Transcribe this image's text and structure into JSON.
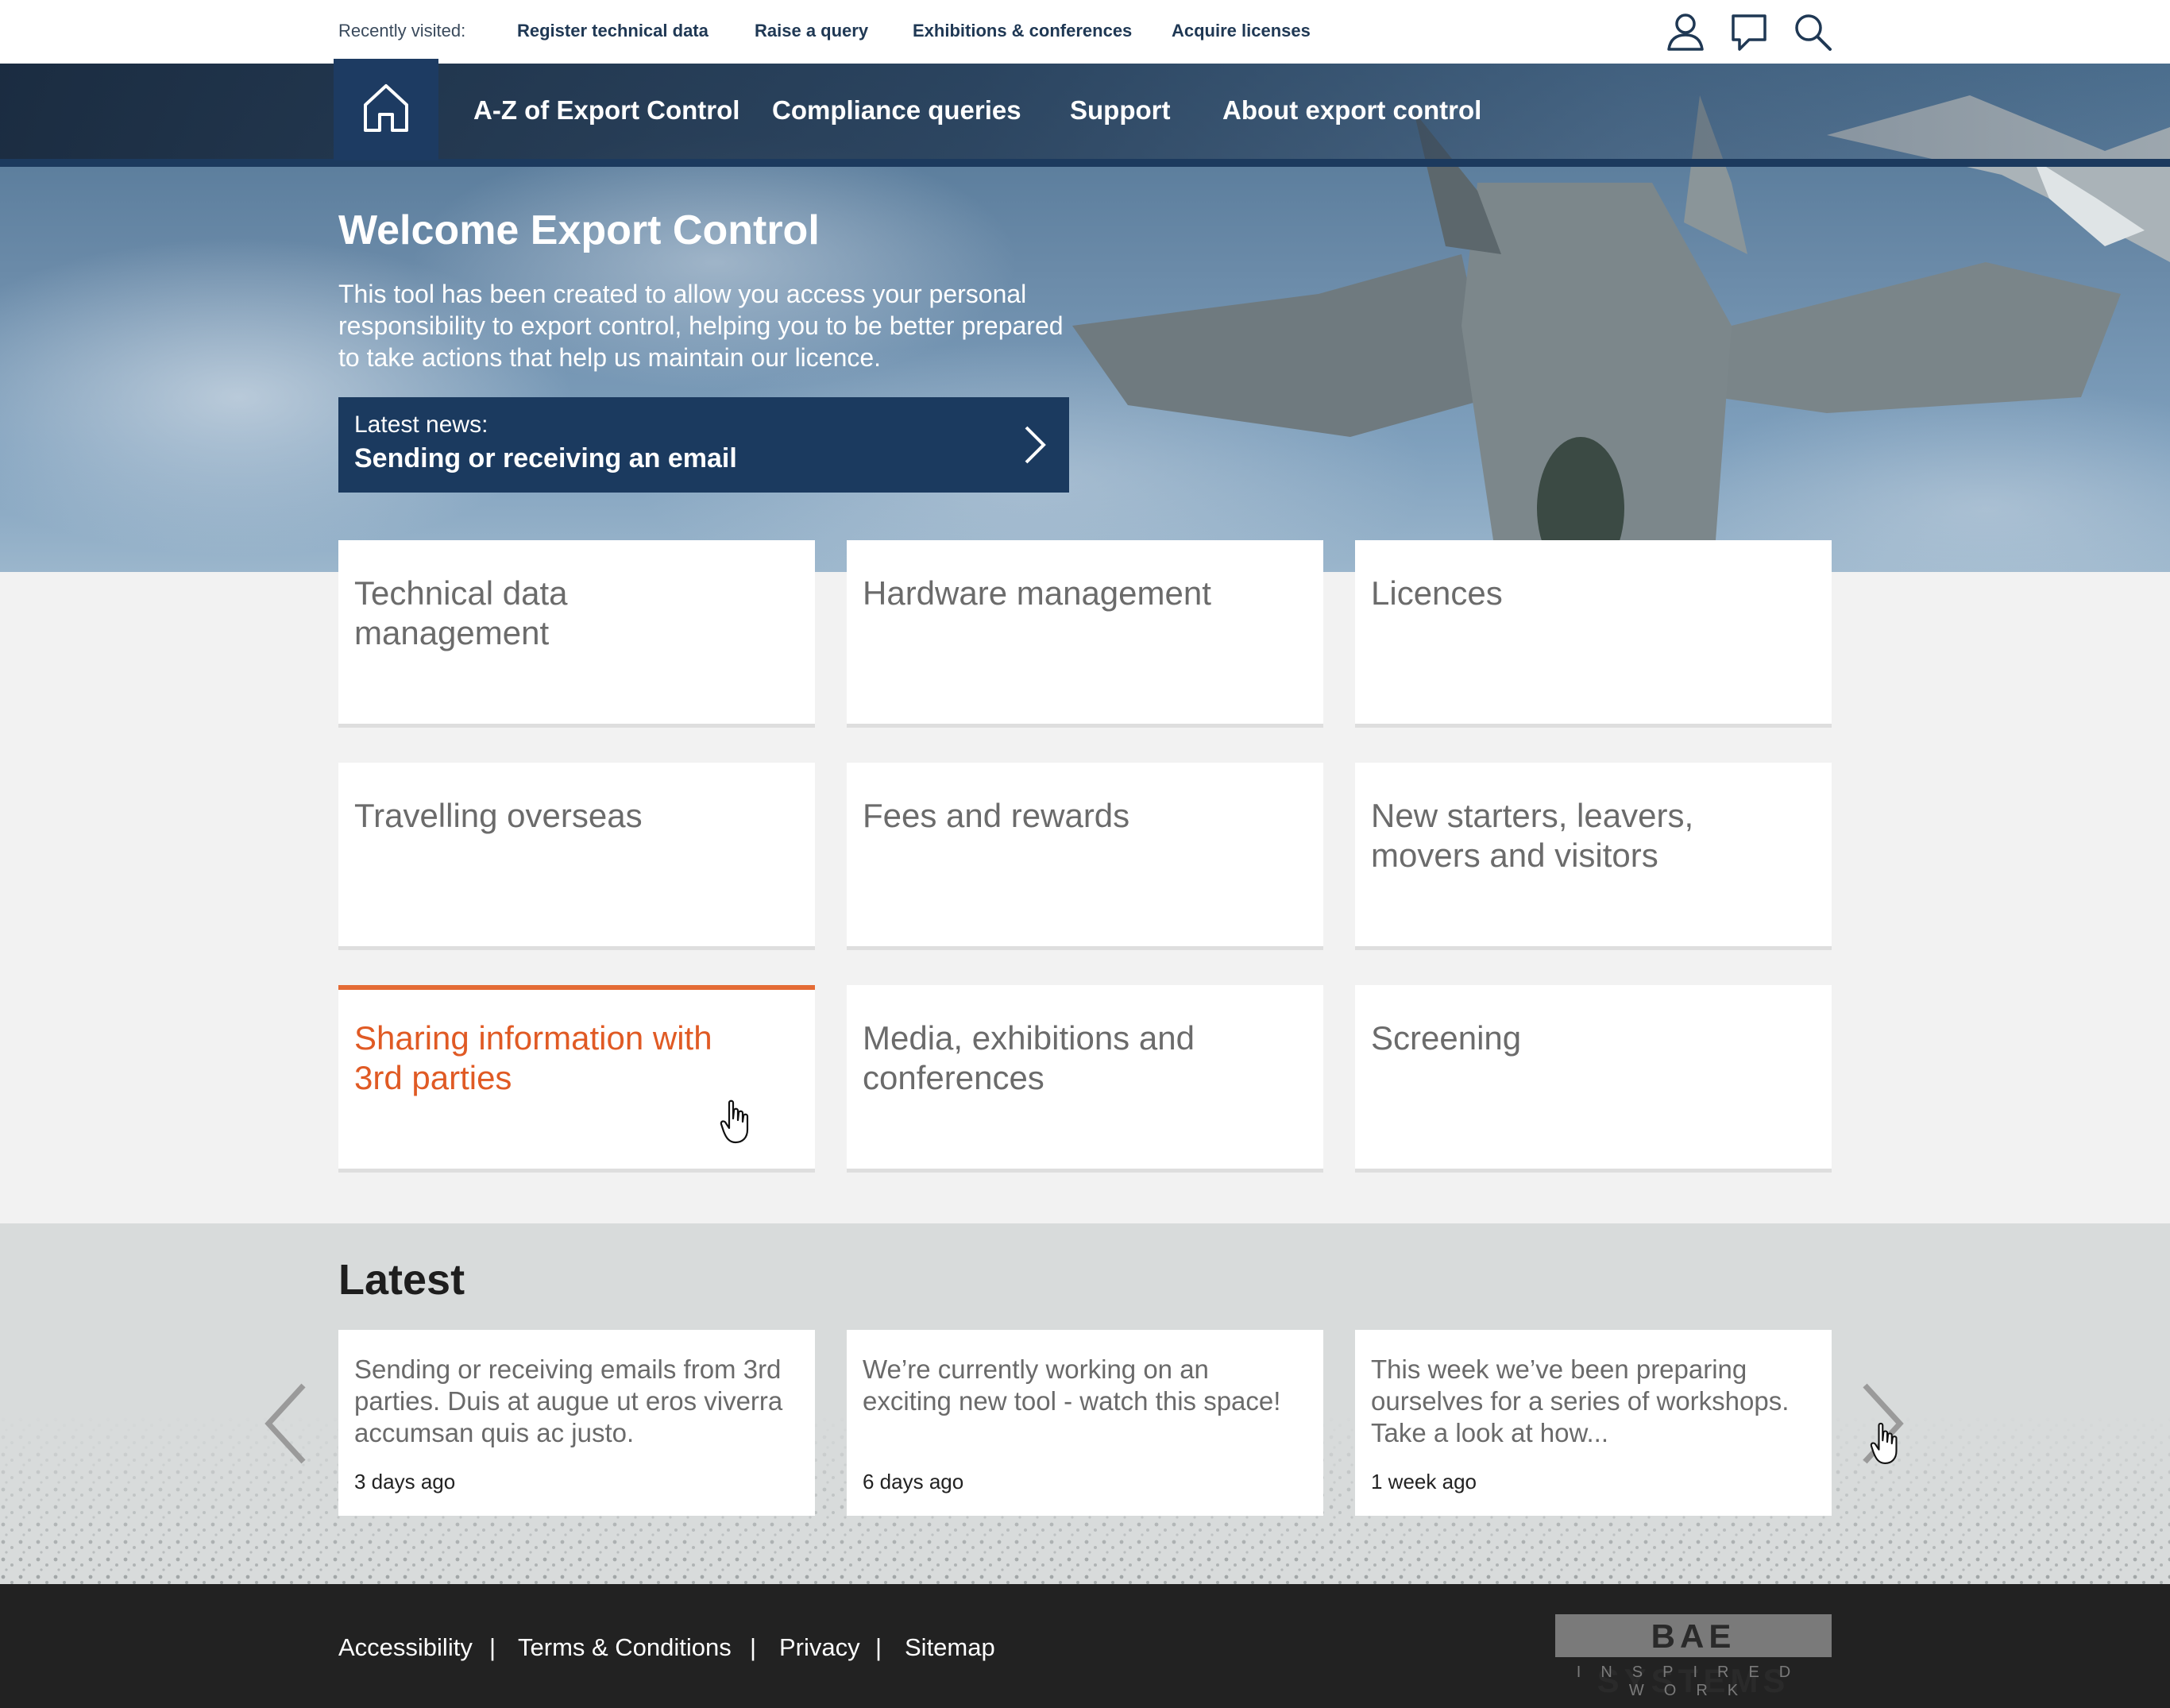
{
  "recently_visited": {
    "label": "Recently visited:",
    "links": [
      "Register technical data",
      "Raise a query",
      "Exhibitions & conferences",
      "Acquire licenses"
    ]
  },
  "utility_icons": [
    "user-icon",
    "chat-icon",
    "search-icon"
  ],
  "nav": {
    "home_icon": "home-icon",
    "items": [
      "A-Z of Export Control",
      "Compliance queries",
      "Support",
      "About export control"
    ]
  },
  "hero": {
    "title": "Welcome Export Control",
    "description": "This tool has been created to allow you access your personal responsibility to export control, helping you to be better prepared to take actions that help us maintain our licence.",
    "news_label": "Latest news:",
    "news_title": "Sending or receiving an email"
  },
  "tiles": [
    "Technical data management",
    "Hardware management",
    "Licences",
    "Travelling overseas",
    "Fees and rewards",
    "New starters, leavers, movers and visitors",
    "Sharing information with 3rd parties",
    "Media, exhibitions and conferences",
    "Screening"
  ],
  "latest": {
    "title": "Latest",
    "cards": [
      {
        "text": "Sending or receiving emails from 3rd parties. Duis at augue ut eros viverra accumsan quis ac justo.",
        "date": "3 days ago"
      },
      {
        "text": "We’re currently working on an exciting new tool - watch this space!",
        "date": "6 days ago"
      },
      {
        "text": "This week we’ve been preparing ourselves for a series of workshops. Take a look at how...",
        "date": "1 week ago"
      }
    ]
  },
  "footer": {
    "links": [
      "Accessibility",
      "Terms & Conditions",
      "Privacy",
      "Sitemap"
    ],
    "separator": "|",
    "logo_main": "BAE SYSTEMS",
    "logo_sub": "INSPIRED WORK"
  },
  "colors": {
    "navy": "#1b3a5f",
    "accent_orange": "#e05a24",
    "footer_bg": "#222222",
    "latest_bg": "#d8dbdb"
  }
}
